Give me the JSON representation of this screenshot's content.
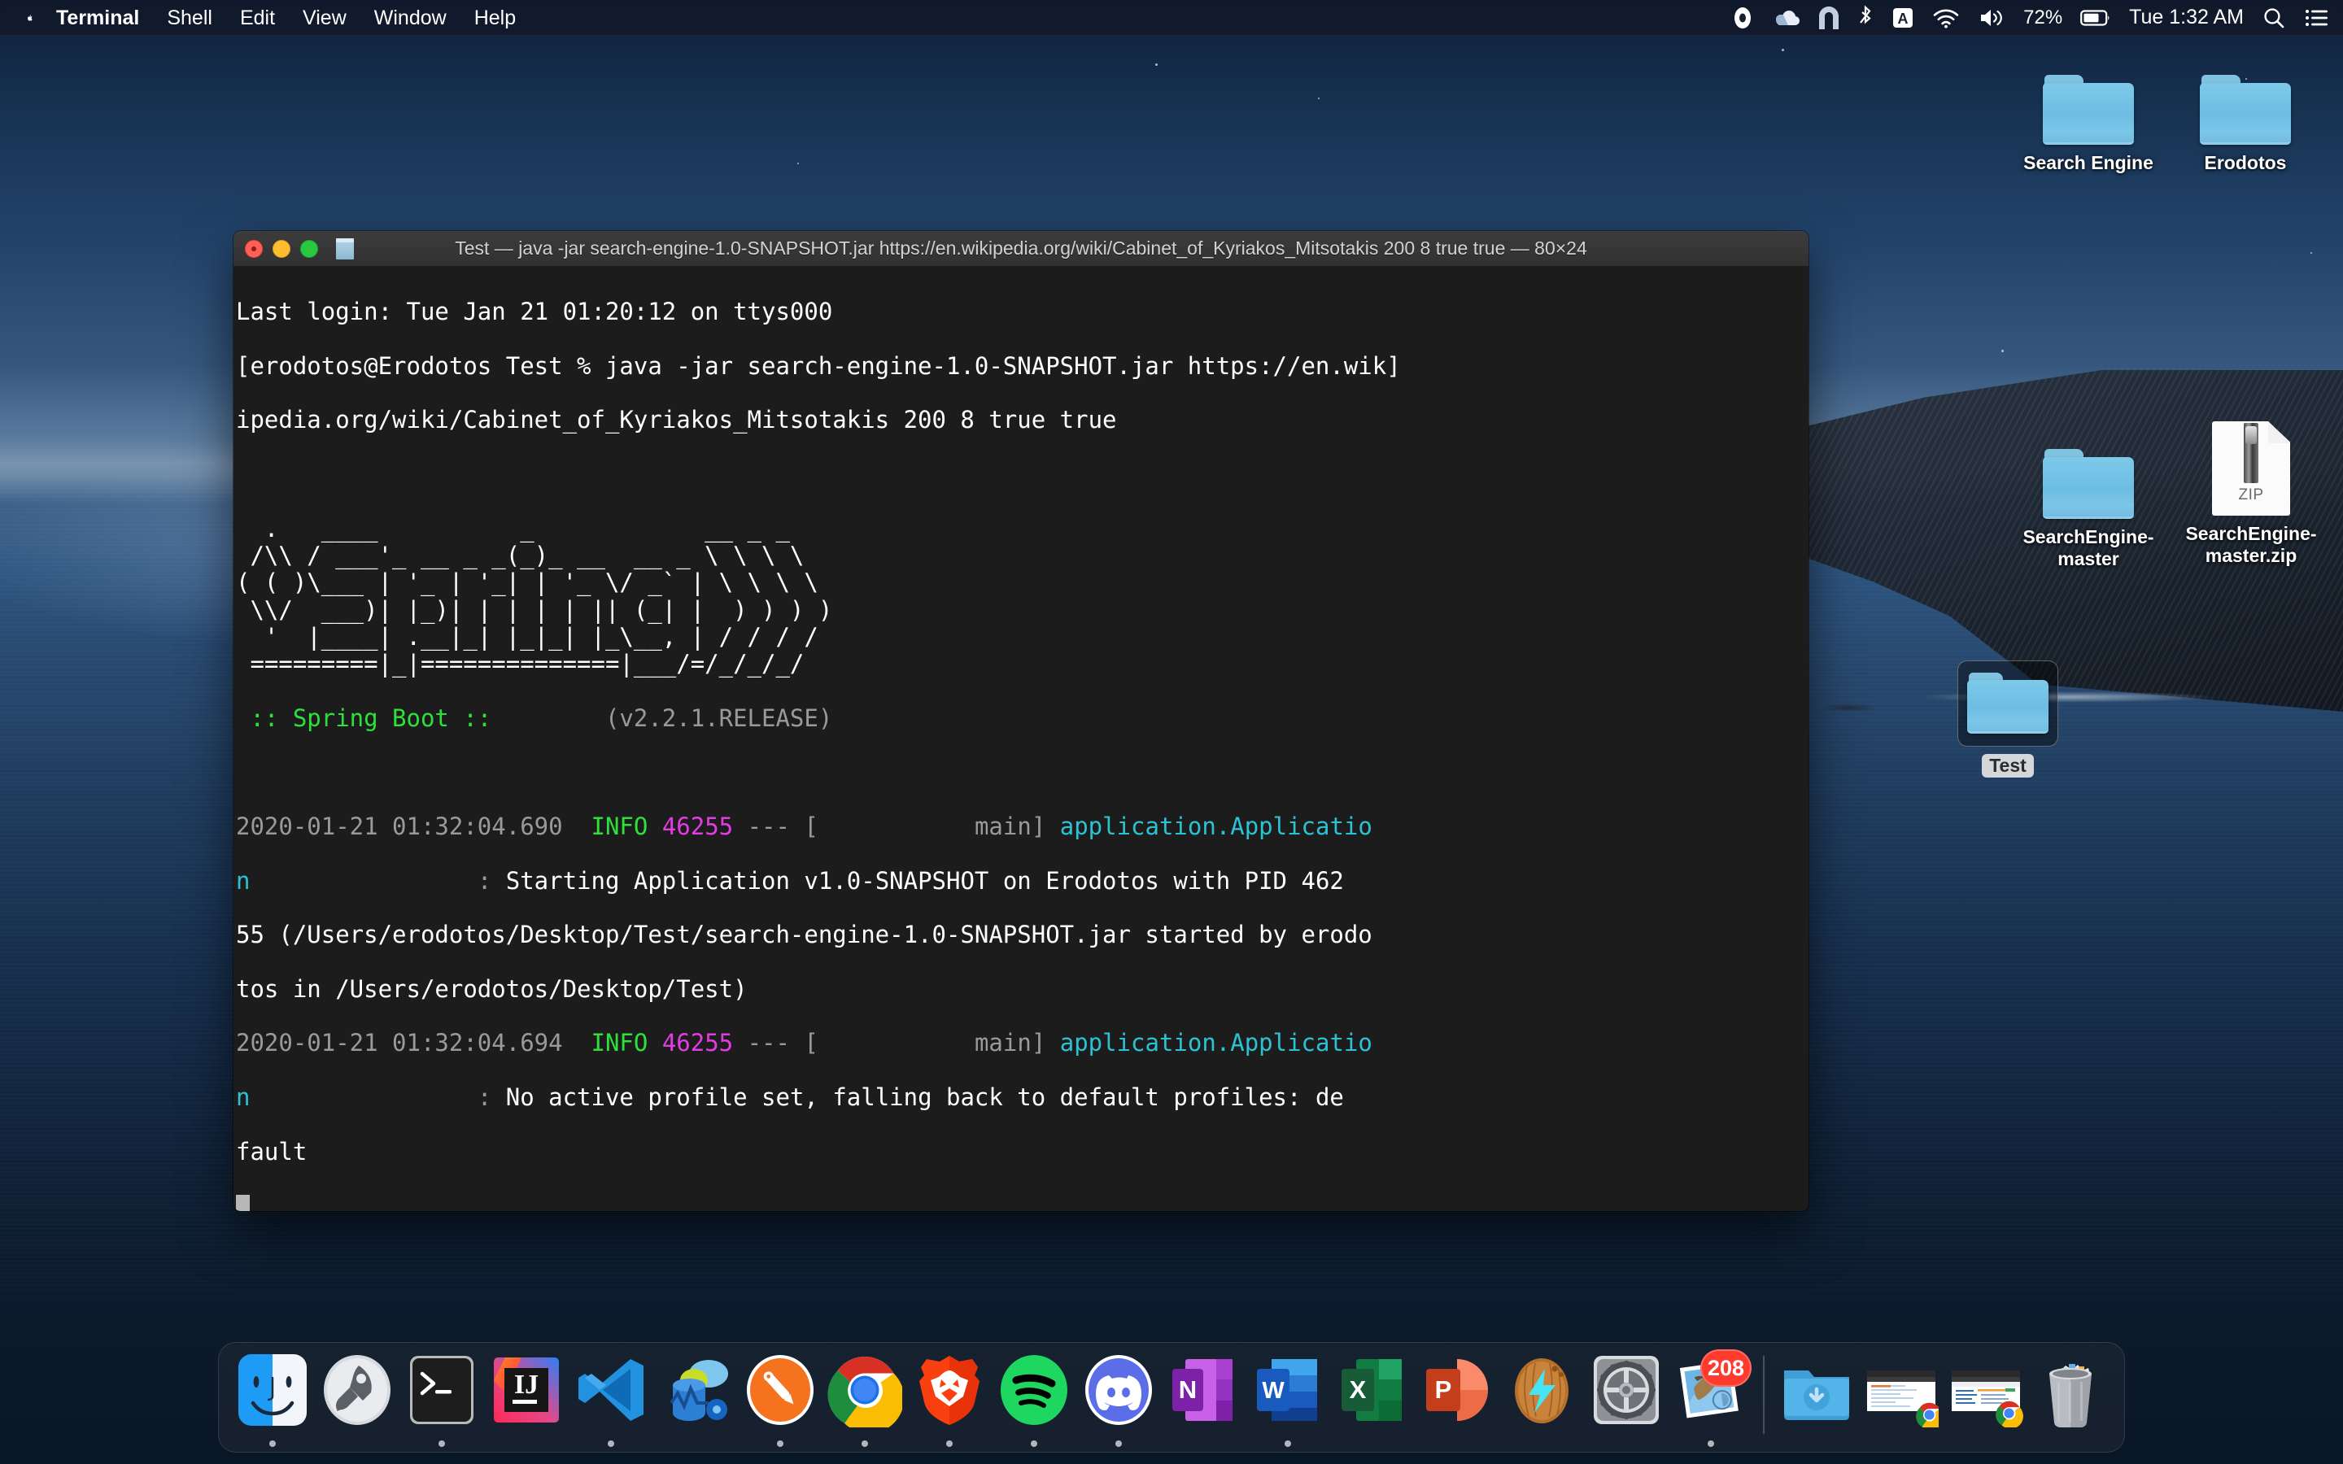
{
  "menubar": {
    "apple_icon": "apple-logo",
    "items": [
      {
        "label": "Terminal",
        "bold": true
      },
      {
        "label": "Shell",
        "bold": false
      },
      {
        "label": "Edit",
        "bold": false
      },
      {
        "label": "View",
        "bold": false
      },
      {
        "label": "Window",
        "bold": false
      },
      {
        "label": "Help",
        "bold": false
      }
    ],
    "status": {
      "record_icon": "record-icon",
      "cloud_icon": "onedrive-cloud-icon",
      "arc_icon": "arc-icon",
      "bluetooth_icon": "bluetooth-icon",
      "keyboard_icon": "keyboard-input-A-icon",
      "wifi_icon": "wifi-icon",
      "volume_icon": "volume-icon",
      "battery_percent": "72%",
      "battery_icon": "battery-icon",
      "clock": "Tue 1:32 AM",
      "search_icon": "spotlight-search-icon",
      "control_center_icon": "control-center-icon"
    }
  },
  "desktop": {
    "icons": [
      {
        "name": "Search Engine",
        "type": "folder",
        "selected": false
      },
      {
        "name": "Erodotos",
        "type": "folder",
        "selected": false
      },
      {
        "name": "SearchEngine-master",
        "type": "folder",
        "selected": false
      },
      {
        "name": "SearchEngine-master.zip",
        "type": "zip",
        "zip_label": "ZIP",
        "selected": false
      },
      {
        "name": "Test",
        "type": "folder",
        "selected": true
      }
    ]
  },
  "terminal": {
    "traffic_lights": [
      "close-button",
      "minimize-button",
      "zoom-button"
    ],
    "title": "Test — java -jar search-engine-1.0-SNAPSHOT.jar https://en.wikipedia.org/wiki/Cabinet_of_Kyriakos_Mitsotakis 200 8 true true — 80×24",
    "last_login": "Last login: Tue Jan 21 01:20:12 on ttys000",
    "prompt_line_1": "[erodotos@Erodotos Test % java -jar search-engine-1.0-SNAPSHOT.jar https://en.wik]",
    "prompt_line_2": "ipedia.org/wiki/Cabinet_of_Kyriakos_Mitsotakis 200 8 true true",
    "banner_ascii": "  .   ____          _            __ _ _\n /\\\\ / ___'_ __ _ _(_)_ __  __ _ \\ \\ \\ \\\n( ( )\\___ | '_ | '_| | '_ \\/ _` | \\ \\ \\ \\\n \\\\/  ___)| |_)| | | | | || (_| |  ) ) ) )\n  '  |____| .__|_| |_|_| |_\\__, | / / / /\n =========|_|==============|___/=/_/_/_/",
    "banner_name": " :: Spring Boot :: ",
    "banner_version": "       (v2.2.1.RELEASE)",
    "logs": [
      {
        "timestamp": "2020-01-21 01:32:04.690",
        "level": "INFO",
        "pid": "46255",
        "sep": "---",
        "bracket_open": "[",
        "thread": "           main]",
        "logger": " application.Applicatio",
        "logger_cont": "n",
        "colon_pad": "                : ",
        "message": "Starting Application v1.0-SNAPSHOT on Erodotos with PID 462",
        "message_wrap_1": "55 (/Users/erodotos/Desktop/Test/search-engine-1.0-SNAPSHOT.jar started by erodo",
        "message_wrap_2": "tos in /Users/erodotos/Desktop/Test)"
      },
      {
        "timestamp": "2020-01-21 01:32:04.694",
        "level": "INFO",
        "pid": "46255",
        "sep": "---",
        "bracket_open": "[",
        "thread": "           main]",
        "logger": " application.Applicatio",
        "logger_cont": "n",
        "colon_pad": "                : ",
        "message": "No active profile set, falling back to default profiles: de",
        "message_wrap_1": "fault",
        "message_wrap_2": ""
      }
    ],
    "colors": {
      "background": "#1c1c1c",
      "text": "#ffffff",
      "dim": "#9a9a9a",
      "info": "#2ee03a",
      "pid": "#e23ce2",
      "logger": "#2bc3d4"
    }
  },
  "dock": {
    "items": [
      {
        "name": "Finder",
        "running": true
      },
      {
        "name": "Launchpad",
        "running": false
      },
      {
        "name": "Terminal",
        "running": true
      },
      {
        "name": "IntelliJ IDEA",
        "running": false
      },
      {
        "name": "Visual Studio Code",
        "running": true
      },
      {
        "name": "Azure Data Studio",
        "running": false
      },
      {
        "name": "Postman",
        "running": true
      },
      {
        "name": "Google Chrome",
        "running": true
      },
      {
        "name": "Brave Browser",
        "running": true
      },
      {
        "name": "Spotify",
        "running": true
      },
      {
        "name": "Discord",
        "running": true
      },
      {
        "name": "Microsoft OneNote",
        "running": false
      },
      {
        "name": "Microsoft Word",
        "running": true
      },
      {
        "name": "Microsoft Excel",
        "running": false
      },
      {
        "name": "Microsoft PowerPoint",
        "running": false
      },
      {
        "name": "Coconut Battery",
        "running": false
      },
      {
        "name": "System Preferences",
        "running": false
      },
      {
        "name": "Mail",
        "running": true,
        "badge": "208"
      }
    ],
    "right_items": [
      {
        "name": "Downloads",
        "type": "folder-stack"
      },
      {
        "name": "Chrome Window 1",
        "type": "minimized-window"
      },
      {
        "name": "Chrome Window 2",
        "type": "minimized-window"
      },
      {
        "name": "Trash",
        "type": "trash"
      }
    ]
  }
}
